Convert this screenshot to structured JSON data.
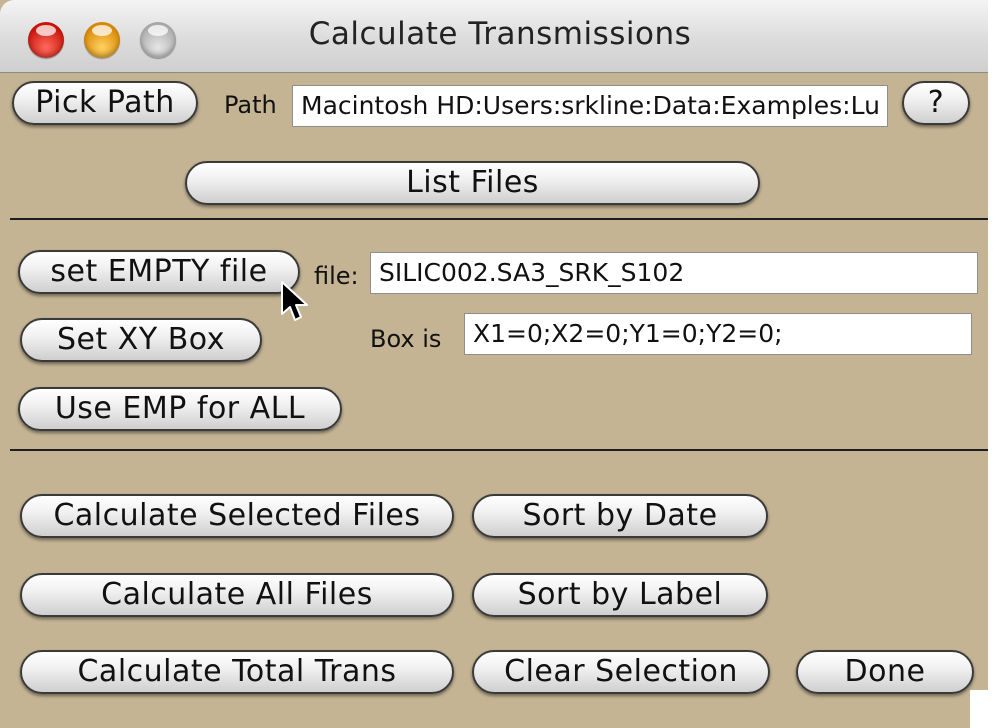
{
  "window": {
    "title": "Calculate Transmissions"
  },
  "path_row": {
    "pick_path_label": "Pick Path",
    "path_label": "Path",
    "path_value": "Macintosh HD:Users:srkline:Data:Examples:Lu",
    "help_label": "?"
  },
  "list_files_label": "List Files",
  "empty_section": {
    "set_empty_label": "set EMPTY file",
    "file_label": "file:",
    "file_value": "SILIC002.SA3_SRK_S102",
    "set_xy_label": "Set XY Box",
    "box_label": "Box is",
    "box_value": "X1=0;X2=0;Y1=0;Y2=0;",
    "use_emp_label": "Use EMP for ALL"
  },
  "actions": {
    "calc_selected": "Calculate Selected Files",
    "sort_date": "Sort by Date",
    "calc_all": "Calculate All Files",
    "sort_label": "Sort by Label",
    "calc_total": "Calculate Total Trans",
    "clear_selection": "Clear Selection",
    "done": "Done"
  },
  "colors": {
    "panel_bg": "#c4b494",
    "titlebar": "#e4e4e4",
    "close": "#e0281c",
    "minimize": "#f2a91c",
    "zoom": "#c4c4c4"
  },
  "icons": [
    "close-icon",
    "minimize-icon",
    "zoom-icon",
    "pointer-cursor-icon"
  ]
}
